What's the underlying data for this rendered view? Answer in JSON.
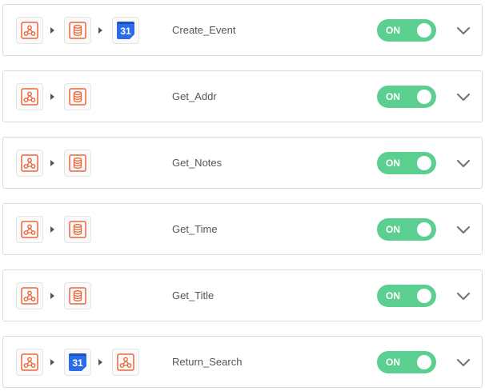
{
  "colors": {
    "toggle_on": "#5bcf8f",
    "app_orange": "#e9663a",
    "gcal_blue": "#2a6bea",
    "gcal_dark": "#1b4fc2",
    "chevron": "#777777"
  },
  "zaps": [
    {
      "title": "Create_Event",
      "steps": [
        "webhook-icon",
        "storage-icon",
        "google-calendar-icon"
      ],
      "toggle": "ON"
    },
    {
      "title": "Get_Addr",
      "steps": [
        "webhook-icon",
        "storage-icon"
      ],
      "toggle": "ON"
    },
    {
      "title": "Get_Notes",
      "steps": [
        "webhook-icon",
        "storage-icon"
      ],
      "toggle": "ON"
    },
    {
      "title": "Get_Time",
      "steps": [
        "webhook-icon",
        "storage-icon"
      ],
      "toggle": "ON"
    },
    {
      "title": "Get_Title",
      "steps": [
        "webhook-icon",
        "storage-icon"
      ],
      "toggle": "ON"
    },
    {
      "title": "Return_Search",
      "steps": [
        "webhook-icon",
        "google-calendar-icon",
        "webhook-icon"
      ],
      "toggle": "ON"
    }
  ],
  "calendar_badge_text": "31"
}
